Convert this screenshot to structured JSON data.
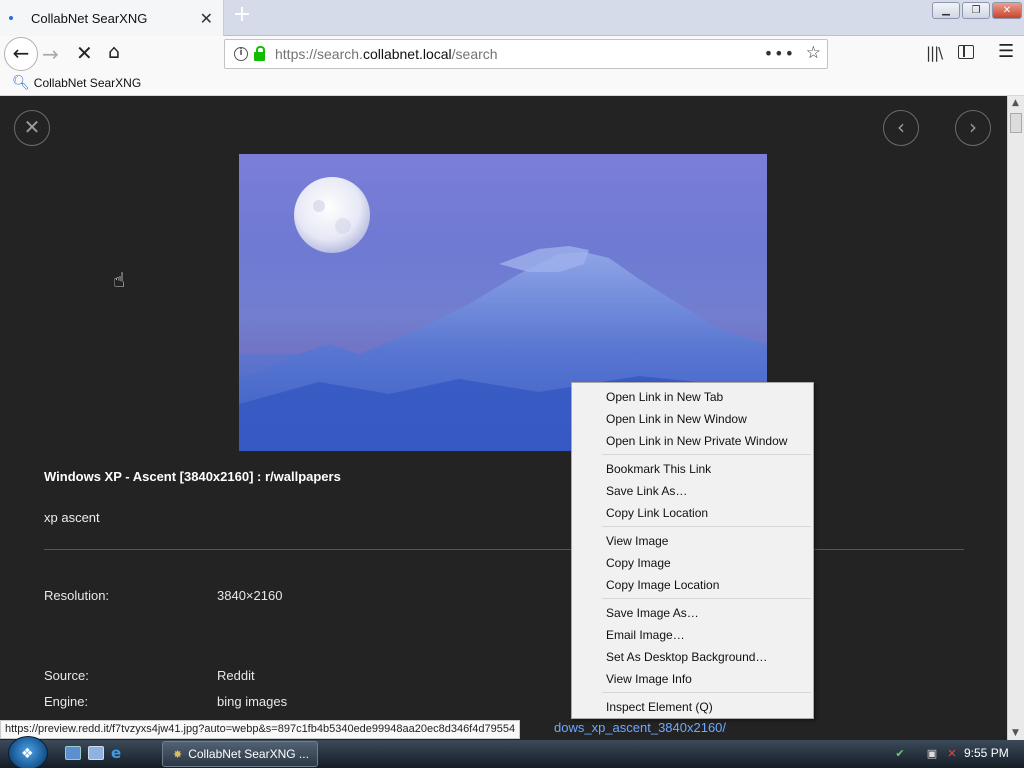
{
  "browser": {
    "tab_title": "CollabNet SearXNG",
    "url_prefix": "https://search.",
    "url_host": "collabnet.local",
    "url_path": "/search",
    "bookmark_label": "CollabNet SearXNG",
    "status_url": "https://preview.redd.it/f7tvzyxs4jw41.jpg?auto=webp&s=897c1fb4b5340ede99948aa20ec8d346f4d79554"
  },
  "result": {
    "title": "Windows XP - Ascent [3840x2160] : r/wallpapers",
    "description": "xp ascent",
    "meta": [
      {
        "label": "Resolution:",
        "value": "3840×2160"
      },
      {
        "label": "Source:",
        "value": "Reddit"
      },
      {
        "label": "Engine:",
        "value": "bing images"
      }
    ],
    "link_fragment": "dows_xp_ascent_3840x2160/"
  },
  "context_menu": {
    "groups": [
      [
        "Open Link in New Tab",
        "Open Link in New Window",
        "Open Link in New Private Window"
      ],
      [
        "Bookmark This Link",
        "Save Link As…",
        "Copy Link Location"
      ],
      [
        "View Image",
        "Copy Image",
        "Copy Image Location"
      ],
      [
        "Save Image As…",
        "Email Image…",
        "Set As Desktop Background…",
        "View Image Info"
      ],
      [
        "Inspect Element (Q)"
      ]
    ]
  },
  "taskbar": {
    "task_label": "CollabNet SearXNG ...",
    "clock": "9:55 PM"
  },
  "icons": {
    "close_overlay": "close-icon",
    "prev": "chevron-left-icon",
    "next": "chevron-right-icon"
  },
  "colors": {
    "page_bg": "#232323",
    "link": "#6ea8ff",
    "secure_lock": "#12bc00"
  }
}
